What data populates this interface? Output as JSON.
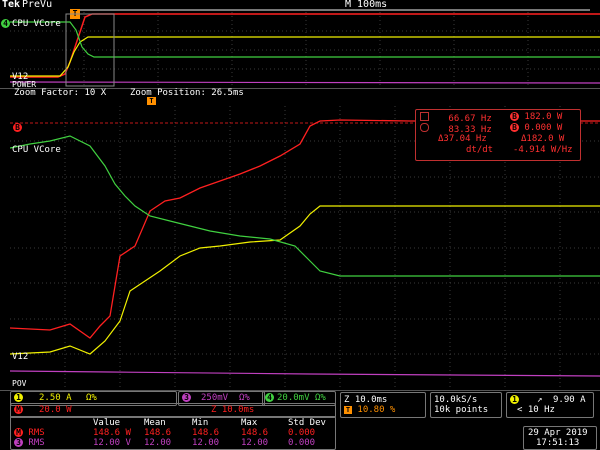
{
  "header": {
    "brand": "Tek",
    "mode": "PreVu",
    "timebase": "M 100ms"
  },
  "overview_labels": {
    "ch4": "4",
    "vcore": "CPU VCore",
    "v12": "V12",
    "power": "POWER"
  },
  "zoom": {
    "factor": "Zoom Factor: 10 X",
    "position": "Zoom Position: 26.5ms"
  },
  "zoom_labels": {
    "ch_m": "B",
    "vcore": "CPU VCore",
    "v12": "V12",
    "pov": "POV"
  },
  "cursor": {
    "row1_left": "66.67 Hz",
    "row1_right": "182.0 W",
    "row2_left": "83.33 Hz",
    "row2_right": "0.000 W",
    "row3_left": "Δ37.04 Hz",
    "row3_right": "Δ182.0 W",
    "row4_label": "dt/dt",
    "row4_right": "-4.914 W/Hz"
  },
  "status": {
    "ch1": "2.50 A",
    "ch1_unit": "Ω%",
    "ch3": "250mV",
    "ch3_unit": "Ω%",
    "ch4": "20.0mV",
    "ch4_unit": "Ω%",
    "math": "20.0 W",
    "math_z": "Z 10.0ms",
    "z_time": "Z 10.0ms",
    "trig_pos": "10.80 %",
    "sample": "10.0kS/s",
    "points": "10k points",
    "trig_ch": "1",
    "trig_val": "9.90 A",
    "trig_freq": "< 10 Hz",
    "date": "29 Apr 2019",
    "time": "17:51:13"
  },
  "measurements": {
    "headers": [
      "Value",
      "Mean",
      "Min",
      "Max",
      "Std Dev"
    ],
    "rows": [
      {
        "ch": "M",
        "label": "RMS",
        "values": [
          "148.6 W",
          "148.6",
          "148.6",
          "148.6",
          "0.000"
        ]
      },
      {
        "ch": "3",
        "label": "RMS",
        "values": [
          "12.00 V",
          "12.00",
          "12.00",
          "12.00",
          "0.000"
        ]
      }
    ]
  },
  "colors": {
    "ch1": "#f0f000",
    "ch3": "#c040c0",
    "ch4": "#40d040",
    "math": "#ff2020",
    "grid": "#3a3a3a",
    "orange": "#ff9000"
  }
}
